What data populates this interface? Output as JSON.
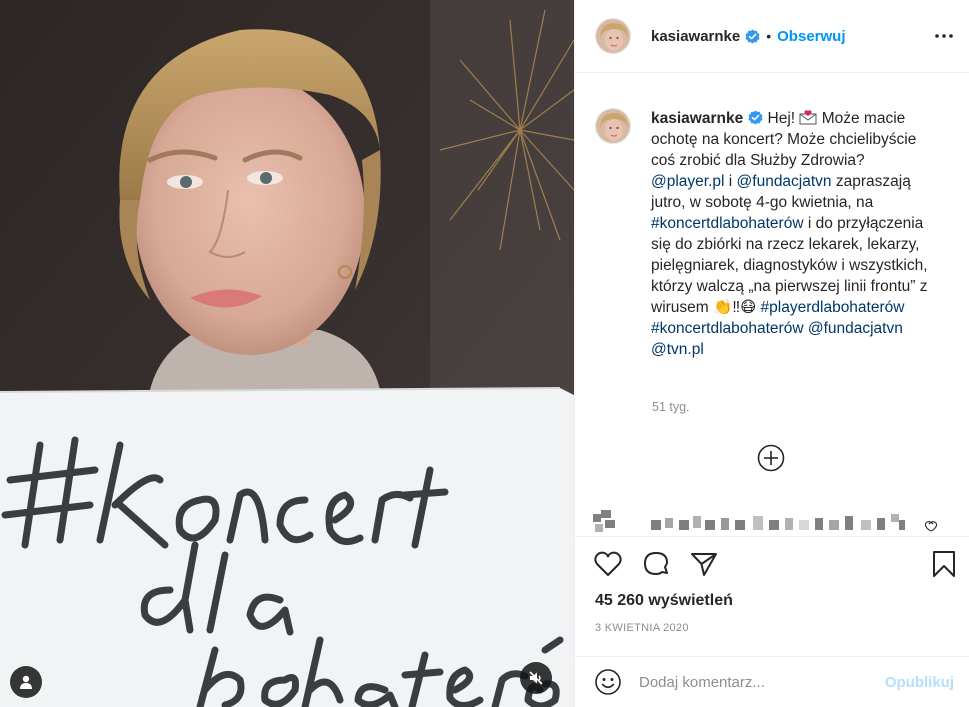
{
  "media": {
    "sign_lines": [
      "# koncert",
      "dla",
      "bohaterów"
    ],
    "tag_icon": "user-tag-icon",
    "mute_icon": "speaker-muted-icon"
  },
  "header": {
    "username": "kasiawarnke",
    "separator": "•",
    "follow_label": "Obserwuj",
    "more_icon": "more-dots-icon"
  },
  "caption": {
    "username": "kasiawarnke",
    "t1": " Hej! ",
    "t2": " Może macie ochotę na koncert? Może chcielibyście coś zrobić dla Służby Zdrowia? ",
    "mention1": "@player.pl",
    "t3": " i ",
    "mention2": "@fundacjatvn",
    "t4": " zapraszają jutro, w sobotę 4-go kwietnia, na ",
    "hashtag1": "#koncertdlabohaterów",
    "t5": " i do przyłączenia się do zbiórki na rzecz lekarek, lekarzy, pielęgniarek, diagnostyków i wszystkich, którzy walczą „na pierwszej linii frontu” z wirusem ",
    "emoji": "👏‼😷",
    "t6": " ",
    "hashtag2": "#playerdlabohaterów",
    "t7": " ",
    "hashtag3": "#koncertdlabohaterów",
    "t8": " ",
    "mention3": "@fundacjatvn",
    "t9": " ",
    "mention4": "@tvn.pl",
    "time_ago": "51 tyg."
  },
  "actions": {
    "views": "45 260 wyświetleń",
    "date": "3 KWIETNIA 2020"
  },
  "comment_box": {
    "placeholder": "Dodaj komentarz...",
    "post_label": "Opublikuj"
  },
  "colors": {
    "accent": "#0095f6",
    "link": "#00376b",
    "muted": "#8e8e8e",
    "border": "#efefef"
  }
}
